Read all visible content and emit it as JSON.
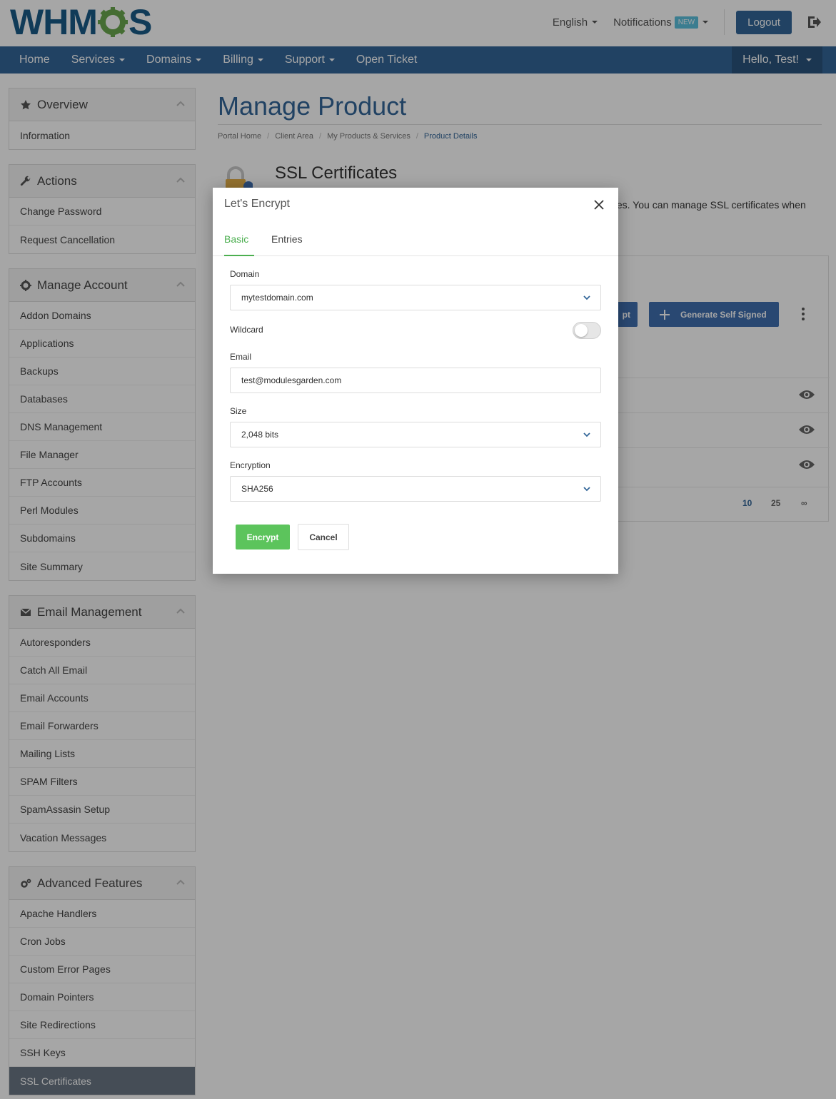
{
  "brand": {
    "logo_text_left": "WHM",
    "logo_text_right": "S",
    "accent": "#336699",
    "green": "#5cc45c"
  },
  "topbar": {
    "language": "English",
    "notifications": "Notifications",
    "notifications_badge": "NEW",
    "logout": "Logout"
  },
  "nav": {
    "items": [
      "Home",
      "Services",
      "Domains",
      "Billing",
      "Support",
      "Open Ticket"
    ],
    "user": "Hello, Test!"
  },
  "sidebar": {
    "overview": {
      "title": "Overview",
      "items": [
        "Information"
      ]
    },
    "actions": {
      "title": "Actions",
      "items": [
        "Change Password",
        "Request Cancellation"
      ]
    },
    "manage": {
      "title": "Manage Account",
      "items": [
        "Addon Domains",
        "Applications",
        "Backups",
        "Databases",
        "DNS Management",
        "File Manager",
        "FTP Accounts",
        "Perl Modules",
        "Subdomains",
        "Site Summary"
      ]
    },
    "email": {
      "title": "Email Management",
      "items": [
        "Autoresponders",
        "Catch All Email",
        "Email Accounts",
        "Email Forwarders",
        "Mailing Lists",
        "SPAM Filters",
        "SpamAssasin Setup",
        "Vacation Messages"
      ]
    },
    "advanced": {
      "title": "Advanced Features",
      "items": [
        "Apache Handlers",
        "Cron Jobs",
        "Custom Error Pages",
        "Domain Pointers",
        "Site Redirections",
        "SSH Keys",
        "SSL Certificates"
      ],
      "active_index": 6
    }
  },
  "main": {
    "title": "Manage Product",
    "breadcrumb": [
      "Portal Home",
      "Client Area",
      "My Products & Services",
      "Product Details"
    ],
    "section_title": "SSL Certificates",
    "section_desc_visible": "tes. You can manage SSL certificates when",
    "btn_partial": "pt",
    "btn_generate": "Generate Self Signed",
    "pager": [
      "10",
      "25",
      "∞"
    ]
  },
  "modal": {
    "title": "Let's Encrypt",
    "tabs": [
      "Basic",
      "Entries"
    ],
    "domain_label": "Domain",
    "domain_value": "mytestdomain.com",
    "wildcard_label": "Wildcard",
    "wildcard_on": false,
    "email_label": "Email",
    "email_value": "test@modulesgarden.com",
    "size_label": "Size",
    "size_value": "2,048 bits",
    "encryption_label": "Encryption",
    "encryption_value": "SHA256",
    "encrypt_button": "Encrypt",
    "cancel_button": "Cancel"
  }
}
